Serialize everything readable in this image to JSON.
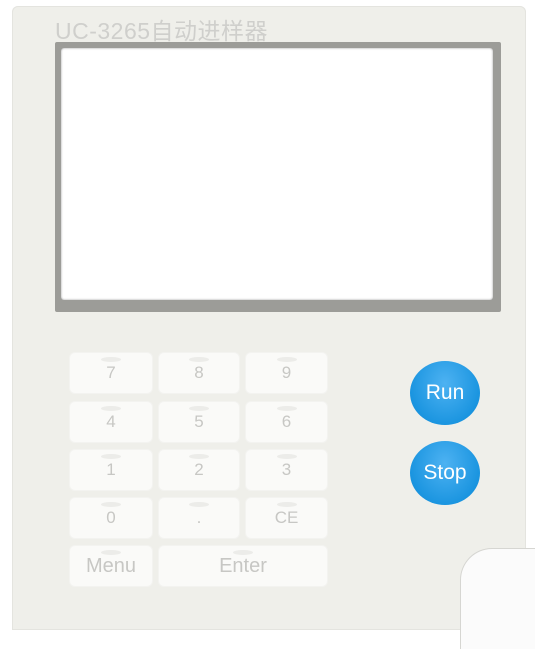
{
  "device": {
    "brand_text": "UC-3265自动进样器"
  },
  "keypad": {
    "keys": [
      "7",
      "8",
      "9",
      "4",
      "5",
      "6",
      "1",
      "2",
      "3",
      "0",
      ".",
      "CE"
    ],
    "menu_label": "Menu",
    "enter_label": "Enter"
  },
  "buttons": {
    "run_label": "Run",
    "stop_label": "Stop"
  },
  "colors": {
    "panel": "#efefea",
    "action_button": "#1b95e0"
  }
}
